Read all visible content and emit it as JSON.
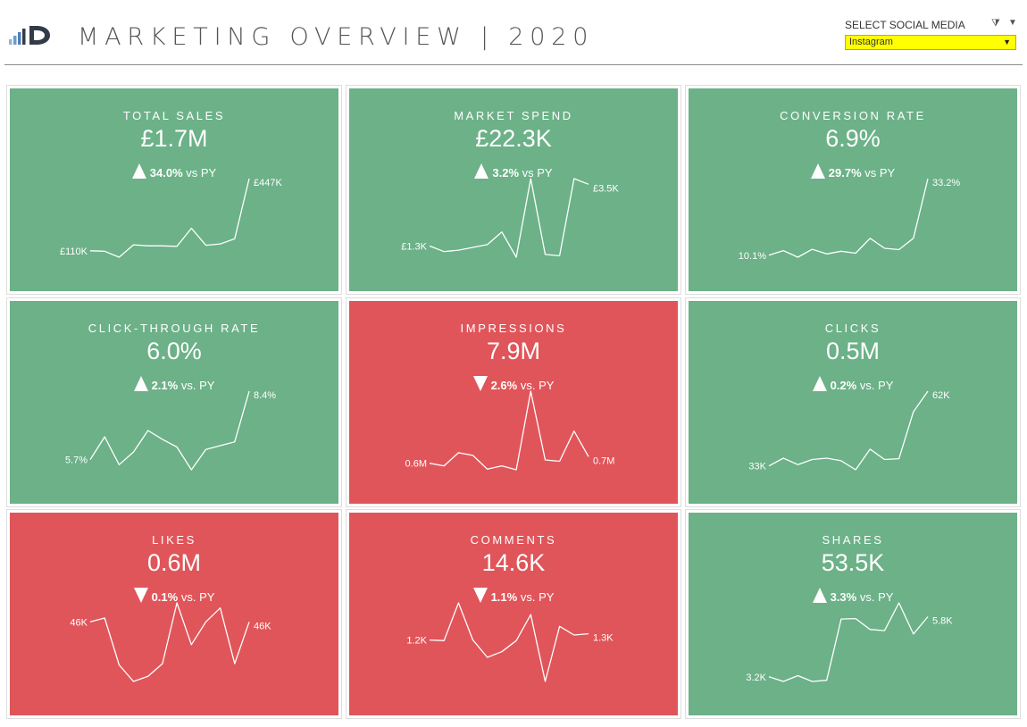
{
  "header": {
    "title": "MARKETING OVERVIEW | 2020",
    "logo_icon": "bar-chart-id-logo",
    "filter": {
      "label": "SELECT SOCIAL MEDIA",
      "value": "Instagram",
      "clear_icon": "filter-clear-icon",
      "menu_icon": "dropdown-menu-icon",
      "highlight_color": "#ffff00"
    }
  },
  "colors": {
    "positive": "#6cb188",
    "negative": "#e0555a",
    "text": "#ffffff"
  },
  "chart_data": [
    {
      "type": "line",
      "title": "TOTAL SALES",
      "value": "£1.7M",
      "direction": "up",
      "change": "34.0%",
      "suffix": "vs PY",
      "status": "positive",
      "x": [
        1,
        2,
        3,
        4,
        5,
        6,
        7,
        8,
        9,
        10,
        11,
        12
      ],
      "values": [
        110,
        108,
        80,
        138,
        133,
        133,
        131,
        215,
        136,
        142,
        166,
        447
      ],
      "start_label": "£110K",
      "end_label": "£447K"
    },
    {
      "type": "line",
      "title": "MARKET SPEND",
      "value": "£22.3K",
      "direction": "up",
      "change": "3.2%",
      "suffix": "vs PY",
      "status": "positive",
      "x": [
        1,
        2,
        3,
        4,
        5,
        6,
        7,
        8,
        9,
        10,
        11,
        12
      ],
      "values": [
        1.3,
        1.1,
        1.15,
        1.25,
        1.35,
        1.8,
        0.9,
        3.7,
        1.0,
        0.95,
        3.7,
        3.5
      ],
      "start_label": "£1.3K",
      "end_label": "£3.5K"
    },
    {
      "type": "line",
      "title": "CONVERSION RATE",
      "value": "6.9%",
      "direction": "up",
      "change": "29.7%",
      "suffix": "vs PY",
      "status": "positive",
      "x": [
        1,
        2,
        3,
        4,
        5,
        6,
        7,
        8,
        9,
        10,
        11,
        12
      ],
      "values": [
        10.1,
        11.5,
        9.5,
        11.9,
        10.5,
        11.3,
        10.7,
        15.2,
        12.2,
        11.8,
        15.2,
        33.2
      ],
      "start_label": "10.1%",
      "end_label": "33.2%"
    },
    {
      "type": "line",
      "title": "CLICK-THROUGH RATE",
      "value": "6.0%",
      "direction": "up",
      "change": "2.1%",
      "suffix": "vs. PY",
      "status": "positive",
      "x": [
        1,
        2,
        3,
        4,
        5,
        6,
        7,
        8,
        9,
        10,
        11,
        12
      ],
      "values": [
        5.7,
        6.6,
        5.5,
        6.0,
        6.85,
        6.5,
        6.2,
        5.3,
        6.1,
        6.25,
        6.4,
        8.4
      ],
      "start_label": "5.7%",
      "end_label": "8.4%"
    },
    {
      "type": "line",
      "title": "IMPRESSIONS",
      "value": "7.9M",
      "direction": "down",
      "change": "2.6%",
      "suffix": "vs. PY",
      "status": "negative",
      "x": [
        1,
        2,
        3,
        4,
        5,
        6,
        7,
        8,
        9,
        10,
        11,
        12
      ],
      "values": [
        0.6,
        0.56,
        0.76,
        0.72,
        0.51,
        0.56,
        0.5,
        1.7,
        0.65,
        0.63,
        1.09,
        0.7
      ],
      "start_label": "0.6M",
      "end_label": "0.7M"
    },
    {
      "type": "line",
      "title": "CLICKS",
      "value": "0.5M",
      "direction": "up",
      "change": "0.2%",
      "suffix": "vs. PY",
      "status": "positive",
      "x": [
        1,
        2,
        3,
        4,
        5,
        6,
        7,
        8,
        9,
        10,
        11,
        12
      ],
      "values": [
        33,
        36,
        33.5,
        35.5,
        36,
        35,
        31.5,
        39.5,
        35.5,
        35.8,
        54,
        62
      ],
      "start_label": "33K",
      "end_label": "62K"
    },
    {
      "type": "line",
      "title": "LIKES",
      "value": "0.6M",
      "direction": "down",
      "change": "0.1%",
      "suffix": "vs. PY",
      "status": "negative",
      "x": [
        1,
        2,
        3,
        4,
        5,
        6,
        7,
        8,
        9,
        10,
        11,
        12
      ],
      "values": [
        46,
        47.5,
        29,
        22.5,
        24.5,
        29.5,
        53.5,
        37,
        46,
        51.5,
        29.5,
        46
      ],
      "start_label": "46K",
      "end_label": "46K"
    },
    {
      "type": "line",
      "title": "COMMENTS",
      "value": "14.6K",
      "direction": "down",
      "change": "1.1%",
      "suffix": "vs. PY",
      "status": "negative",
      "x": [
        1,
        2,
        3,
        4,
        5,
        6,
        7,
        8,
        9,
        10,
        11,
        12
      ],
      "values": [
        1.2,
        1.19,
        1.8,
        1.2,
        0.92,
        1.01,
        1.19,
        1.61,
        0.53,
        1.42,
        1.28,
        1.3
      ],
      "start_label": "1.2K",
      "end_label": "1.3K"
    },
    {
      "type": "line",
      "title": "SHARES",
      "value": "53.5K",
      "direction": "up",
      "change": "3.3%",
      "suffix": "vs. PY",
      "status": "positive",
      "x": [
        1,
        2,
        3,
        4,
        5,
        6,
        7,
        8,
        9,
        10,
        11,
        12
      ],
      "values": [
        3.2,
        3.0,
        3.25,
        3.0,
        3.05,
        5.7,
        5.72,
        5.25,
        5.2,
        6.4,
        5.05,
        5.8
      ],
      "start_label": "3.2K",
      "end_label": "5.8K"
    }
  ]
}
